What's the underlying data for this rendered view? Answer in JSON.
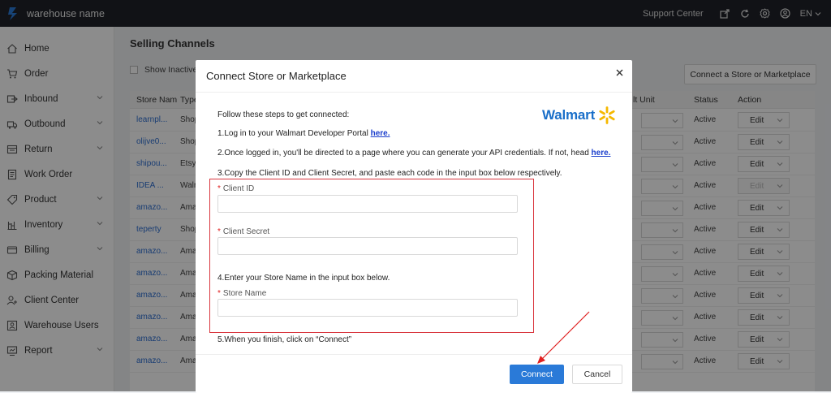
{
  "topbar": {
    "app_name": "warehouse name",
    "support_label": "Support Center",
    "language": "EN",
    "icons": [
      "export-icon",
      "refresh-icon",
      "settings-icon",
      "user-icon"
    ]
  },
  "sidebar": {
    "items": [
      {
        "label": "Home",
        "icon": "home-icon",
        "expandable": false
      },
      {
        "label": "Order",
        "icon": "cart-icon",
        "expandable": false
      },
      {
        "label": "Inbound",
        "icon": "inbound-icon",
        "expandable": true
      },
      {
        "label": "Outbound",
        "icon": "outbound-icon",
        "expandable": true
      },
      {
        "label": "Return",
        "icon": "return-icon",
        "expandable": true
      },
      {
        "label": "Work Order",
        "icon": "work-order-icon",
        "expandable": false
      },
      {
        "label": "Product",
        "icon": "tag-icon",
        "expandable": true
      },
      {
        "label": "Inventory",
        "icon": "inventory-icon",
        "expandable": true
      },
      {
        "label": "Billing",
        "icon": "billing-icon",
        "expandable": true
      },
      {
        "label": "Packing Material",
        "icon": "box-icon",
        "expandable": false
      },
      {
        "label": "Client Center",
        "icon": "client-icon",
        "expandable": false
      },
      {
        "label": "Warehouse Users",
        "icon": "users-icon",
        "expandable": false
      },
      {
        "label": "Report",
        "icon": "report-icon",
        "expandable": true
      }
    ]
  },
  "main": {
    "title": "Selling Channels",
    "show_inactive_label": "Show Inactive S",
    "connect_button": "Connect a Store or Marketplace",
    "table": {
      "headers": {
        "store": "Store Nam",
        "type": "Type",
        "unit": "lt Unit",
        "status": "Status",
        "action": "Action"
      },
      "rows": [
        {
          "store": "learnpl...",
          "type": "Shop",
          "status": "Active",
          "action": "Edit",
          "disabled": false
        },
        {
          "store": "olijve0...",
          "type": "Shop",
          "status": "Active",
          "action": "Edit",
          "disabled": false
        },
        {
          "store": "shipou...",
          "type": "Etsy",
          "status": "Active",
          "action": "Edit",
          "disabled": false
        },
        {
          "store": "IDEA ...",
          "type": "Walr",
          "status": "Active",
          "action": "Edit",
          "disabled": true
        },
        {
          "store": "amazo...",
          "type": "Ama",
          "status": "Active",
          "action": "Edit",
          "disabled": false
        },
        {
          "store": "teperty",
          "type": "Shop",
          "status": "Active",
          "action": "Edit",
          "disabled": false
        },
        {
          "store": "amazo...",
          "type": "Ama",
          "status": "Active",
          "action": "Edit",
          "disabled": false
        },
        {
          "store": "amazo...",
          "type": "Ama",
          "status": "Active",
          "action": "Edit",
          "disabled": false
        },
        {
          "store": "amazo...",
          "type": "Ama",
          "status": "Active",
          "action": "Edit",
          "disabled": false
        },
        {
          "store": "amazo...",
          "type": "Ama",
          "status": "Active",
          "action": "Edit",
          "disabled": false
        },
        {
          "store": "amazo...",
          "type": "Ama",
          "status": "Active",
          "action": "Edit",
          "disabled": false
        },
        {
          "store": "amazo...",
          "type": "Ama",
          "status": "Active",
          "action": "Edit",
          "disabled": false
        }
      ]
    }
  },
  "modal": {
    "title": "Connect Store or Marketplace",
    "brand": "Walmart",
    "intro": "Follow these steps to get connected:",
    "step1_text": "1.Log in to your Walmart Developer Portal ",
    "step1_link": "here.",
    "step2_text": "2.Once logged in, you'll be directed to a page where you can generate your API credentials. If not, head ",
    "step2_link": "here.",
    "step3_text": "3.Copy the Client ID and Client Secret, and paste each code in the input box below respectively.",
    "client_id_label": "Client ID",
    "client_secret_label": "Client Secret",
    "step4_text": "4.Enter your Store Name in the input box below.",
    "store_name_label": "Store Name",
    "step5_text": "5.When you finish, click on “Connect”",
    "required_mark": "*",
    "connect_label": "Connect",
    "cancel_label": "Cancel"
  },
  "colors": {
    "topbar_bg": "#1f2229",
    "primary": "#2a7ad8",
    "link": "#2f6fd1",
    "highlight_red": "#d9363e",
    "walmart_blue": "#1a6fc9",
    "walmart_spark": "#f5b800"
  }
}
